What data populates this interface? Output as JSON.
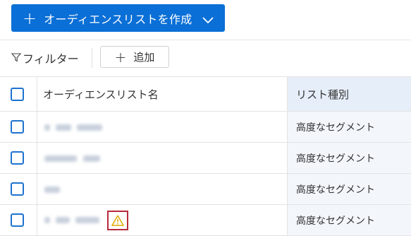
{
  "toolbar": {
    "create_label": "オーディエンスリストを作成",
    "create_icon": "plus-icon",
    "dropdown_icon": "chevron-down-icon",
    "accent_color": "#0a6fd6"
  },
  "filter": {
    "label": "フィルター",
    "icon": "filter-icon",
    "add_label": "追加"
  },
  "table": {
    "headers": {
      "name": "オーディエンスリスト名",
      "type": "リスト種別"
    },
    "rows": [
      {
        "type": "高度なセグメント",
        "warning": false
      },
      {
        "type": "高度なセグメント",
        "warning": false
      },
      {
        "type": "高度なセグメント",
        "warning": false
      },
      {
        "type": "高度なセグメント",
        "warning": true
      }
    ],
    "warning_icon": "warning-icon"
  }
}
